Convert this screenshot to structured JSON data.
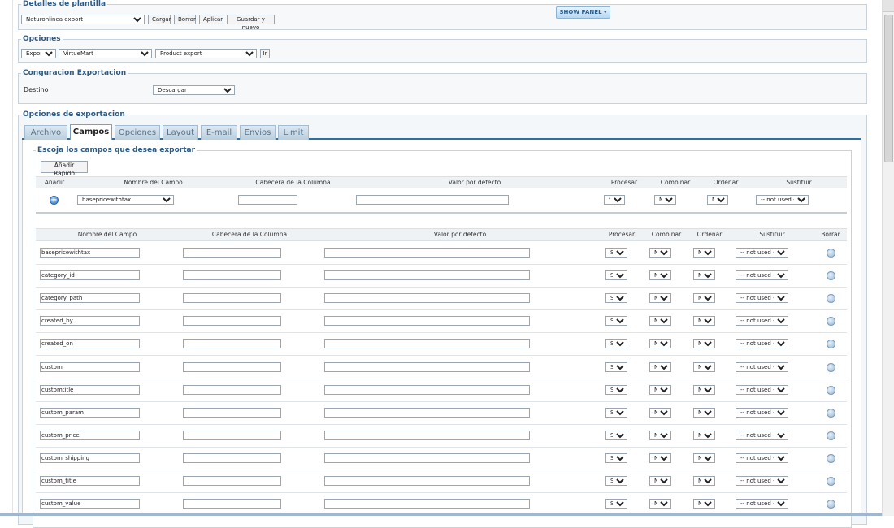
{
  "plantilla": {
    "legend": "Detalles de plantilla",
    "template_value": "Naturonlinea export",
    "buttons": [
      "Cargar",
      "Borrar",
      "Aplicar",
      "Guardar y nuevo"
    ],
    "show_panel": "SHOW PANEL"
  },
  "opciones": {
    "legend": "Opciones",
    "action": "Exportar",
    "component": "VirtueMart",
    "operation": "Product export",
    "go_label": "Ir"
  },
  "configuracion": {
    "legend": "Conguracion Exportacion",
    "destino_label": "Destino",
    "destino_value": "Descargar"
  },
  "export_options": {
    "legend": "Opciones de exportacion",
    "tabs": [
      "Archivo",
      "Campos",
      "Opciones",
      "Layout",
      "E-mail",
      "Envios",
      "Limit"
    ],
    "active_tab": "Campos"
  },
  "fields_section": {
    "legend": "Escoja los campos que desea exportar",
    "quick_add": "Añadir Rapido",
    "add_headers": [
      "Añadir",
      "Nombre del Campo",
      "Cabecera de la Columna",
      "Valor por defecto",
      "Procesar",
      "Combinar",
      "Ordenar",
      "Sustituir"
    ],
    "add_row": {
      "field": "basepricewithtax",
      "procesar": "Sí",
      "combinar": "No",
      "ordenar": "No",
      "sustituir": "-- not used --"
    },
    "list_headers": [
      "Nombre del Campo",
      "Cabecera de la Columna",
      "Valor por defecto",
      "Procesar",
      "Combinar",
      "Ordenar",
      "Sustituir",
      "Borrar"
    ],
    "rows": [
      {
        "field": "basepricewithtax",
        "procesar": "Sí",
        "combinar": "No",
        "ordenar": "No",
        "sustituir": "-- not used --"
      },
      {
        "field": "category_id",
        "procesar": "Sí",
        "combinar": "No",
        "ordenar": "No",
        "sustituir": "-- not used --"
      },
      {
        "field": "category_path",
        "procesar": "Sí",
        "combinar": "No",
        "ordenar": "No",
        "sustituir": "-- not used --"
      },
      {
        "field": "created_by",
        "procesar": "Sí",
        "combinar": "No",
        "ordenar": "No",
        "sustituir": "-- not used --"
      },
      {
        "field": "created_on",
        "procesar": "Sí",
        "combinar": "No",
        "ordenar": "No",
        "sustituir": "-- not used --"
      },
      {
        "field": "custom",
        "procesar": "Sí",
        "combinar": "No",
        "ordenar": "No",
        "sustituir": "-- not used --"
      },
      {
        "field": "customtitle",
        "procesar": "Sí",
        "combinar": "No",
        "ordenar": "No",
        "sustituir": "-- not used --"
      },
      {
        "field": "custom_param",
        "procesar": "Sí",
        "combinar": "No",
        "ordenar": "No",
        "sustituir": "-- not used --"
      },
      {
        "field": "custom_price",
        "procesar": "Sí",
        "combinar": "No",
        "ordenar": "No",
        "sustituir": "-- not used --"
      },
      {
        "field": "custom_shipping",
        "procesar": "Sí",
        "combinar": "No",
        "ordenar": "No",
        "sustituir": "-- not used --"
      },
      {
        "field": "custom_title",
        "procesar": "Sí",
        "combinar": "No",
        "ordenar": "No",
        "sustituir": "-- not used --"
      },
      {
        "field": "custom_value",
        "procesar": "Sí",
        "combinar": "No",
        "ordenar": "No",
        "sustituir": "-- not used --"
      }
    ]
  },
  "colors": {
    "legend_text": "#2f5a82",
    "tab_border": "#2e6ea3",
    "panel_bg": "#f6f8fa"
  }
}
